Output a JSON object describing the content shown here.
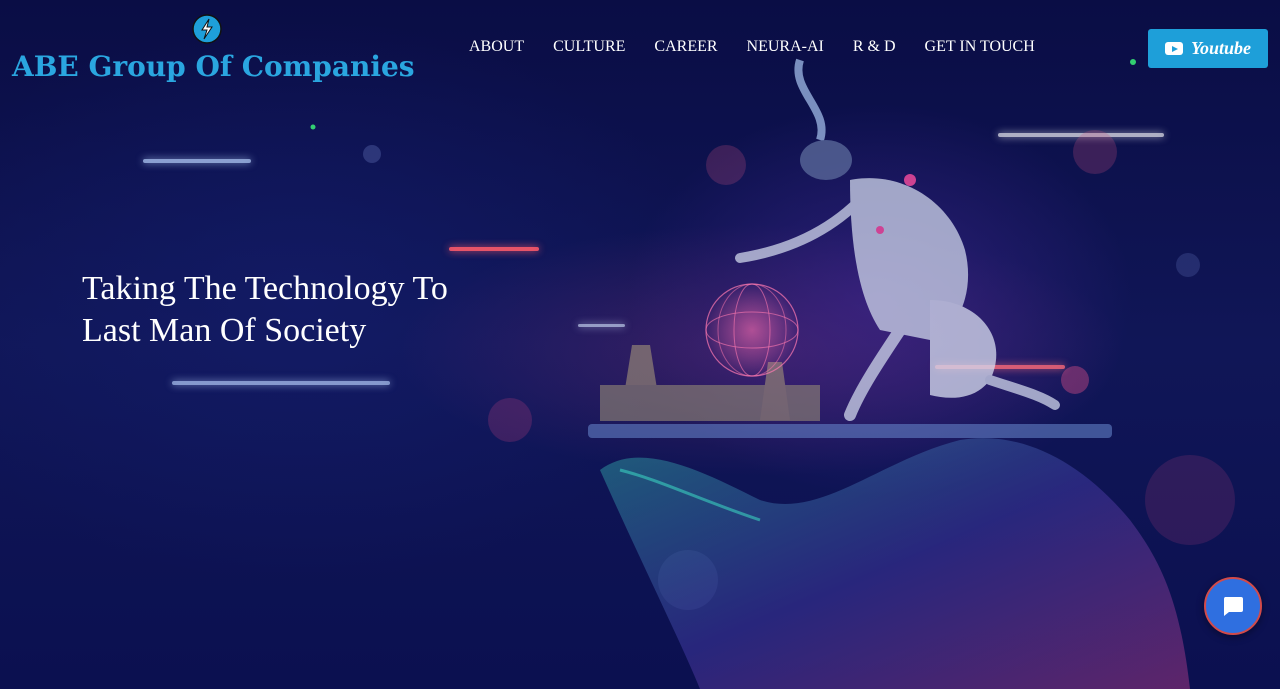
{
  "header": {
    "brand_name": "ABE Group Of Companies",
    "brand_color": "#2aa6e0",
    "logo_icon": "lightning-bolt-icon",
    "nav": [
      {
        "label": "ABOUT"
      },
      {
        "label": "CULTURE"
      },
      {
        "label": "CAREER"
      },
      {
        "label": "NEURA-AI"
      },
      {
        "label": "R & D"
      },
      {
        "label": "GET IN TOUCH"
      }
    ],
    "youtube_button": {
      "label": "Youtube",
      "icon": "youtube-play-icon",
      "color": "#1e9fd9"
    }
  },
  "hero": {
    "title": "Taking The Technology To Last Man Of Society",
    "background_theme": "#0b0f4a"
  },
  "chat_widget": {
    "icon": "chat-bubble-icon",
    "color": "#2f6fe0"
  }
}
